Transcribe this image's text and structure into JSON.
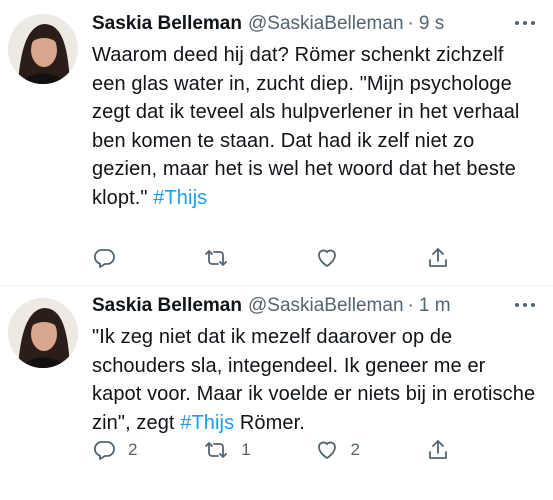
{
  "tweets": [
    {
      "author_name": "Saskia Belleman",
      "handle": "@SaskiaBelleman",
      "separator": "·",
      "time": "9 s",
      "text_before": "Waarom deed hij dat? Römer schenkt zichzelf een glas water in, zucht diep. \"Mijn psychologe zegt dat ik teveel als hulpverlener in het verhaal ben komen te staan. Dat had ik zelf niet zo gezien, maar het is wel het woord dat het beste klopt.\" ",
      "hashtag": "#Thijs",
      "text_after": "",
      "reply_count": "",
      "retweet_count": "",
      "like_count": ""
    },
    {
      "author_name": "Saskia Belleman",
      "handle": "@SaskiaBelleman",
      "separator": "·",
      "time": "1 m",
      "text_before": "\"Ik zeg niet dat ik mezelf daarover op de schouders sla, integendeel. Ik geneer me er kapot voor. Maar ik voelde er niets bij in erotische zin\", zegt ",
      "hashtag": "#Thijs",
      "text_after": " Römer.",
      "reply_count": "2",
      "retweet_count": "1",
      "like_count": "2"
    }
  ],
  "icons": {
    "more": "more-horizontal-icon",
    "reply": "reply-icon",
    "retweet": "retweet-icon",
    "like": "like-heart-icon",
    "share": "share-icon"
  },
  "colors": {
    "hashtag": "#1d9bf0",
    "muted": "#536471",
    "text": "#0f1419",
    "divider": "#eff3f4"
  }
}
